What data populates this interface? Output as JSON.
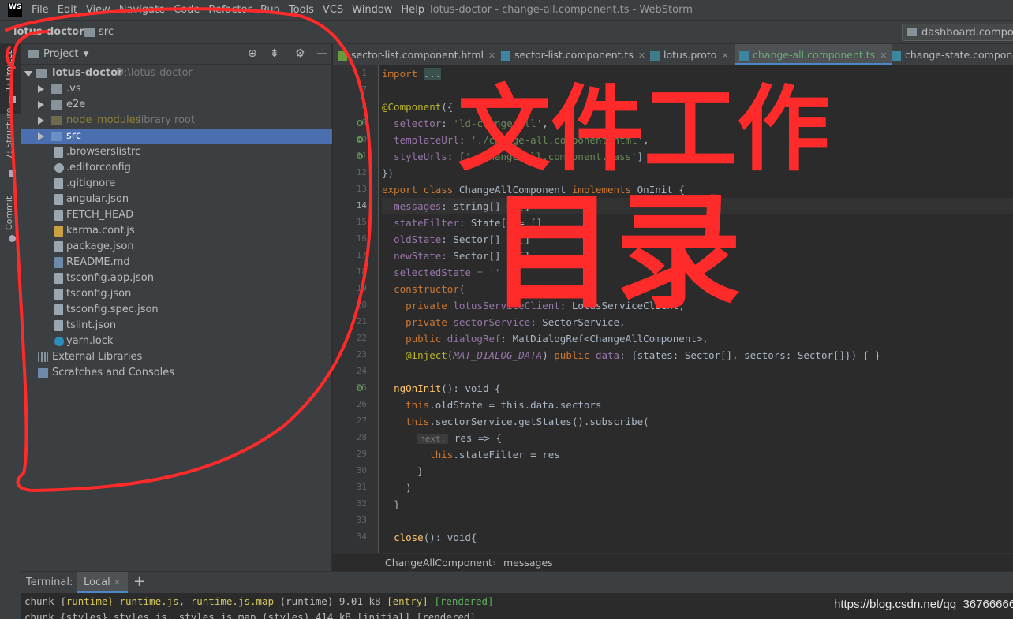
{
  "window": {
    "title": "lotus-doctor - change-all.component.ts - WebStorm",
    "logo": "WS"
  },
  "menu": [
    "File",
    "Edit",
    "View",
    "Navigate",
    "Code",
    "Refactor",
    "Run",
    "Tools",
    "VCS",
    "Window",
    "Help"
  ],
  "nav": {
    "root": "lotus-doctor",
    "folder": "src",
    "run_config": "dashboard.component"
  },
  "toolstrip": {
    "project": "1: Project",
    "structure": "7: Structure",
    "commit": "Commit"
  },
  "project_panel": {
    "title": "Project",
    "tree": [
      {
        "label": "lotus-doctor",
        "hint": "D:\\lotus-doctor"
      },
      {
        "label": ".vs"
      },
      {
        "label": "e2e"
      },
      {
        "label": "node_modules",
        "hint": "library root"
      },
      {
        "label": "src"
      },
      {
        "label": ".browserslistrc"
      },
      {
        "label": ".editorconfig"
      },
      {
        "label": ".gitignore"
      },
      {
        "label": "angular.json"
      },
      {
        "label": "FETCH_HEAD"
      },
      {
        "label": "karma.conf.js"
      },
      {
        "label": "package.json"
      },
      {
        "label": "README.md"
      },
      {
        "label": "tsconfig.app.json"
      },
      {
        "label": "tsconfig.json"
      },
      {
        "label": "tsconfig.spec.json"
      },
      {
        "label": "tslint.json"
      },
      {
        "label": "yarn.lock"
      },
      {
        "label": "External Libraries"
      },
      {
        "label": "Scratches and Consoles"
      }
    ]
  },
  "tabs": [
    {
      "label": "sector-list.component.html"
    },
    {
      "label": "sector-list.component.ts"
    },
    {
      "label": "lotus.proto"
    },
    {
      "label": "change-all.component.ts"
    },
    {
      "label": "change-state.component"
    }
  ],
  "gutter": [
    "1",
    "7",
    "8",
    "9",
    "10",
    "11",
    "12",
    "13",
    "14",
    "15",
    "16",
    "17",
    "18",
    "19",
    "20",
    "21",
    "22",
    "23",
    "24",
    "25",
    "26",
    "27",
    "28",
    "29",
    "30",
    "31",
    "32",
    "33",
    "34"
  ],
  "code": {
    "l1_kw": "import",
    "l1_fold": "...",
    "l8_ann": "@Component",
    "l8_rest": "({",
    "l9_fld": "selector",
    "l9_str": "'ld-change-all'",
    "l10_fld": "templateUrl",
    "l10_str": "'./change-all.component.html'",
    "l11_fld": "styleUrls",
    "l11_str": "'./change-all.component.sass'",
    "l12": "})",
    "l13_kw1": "export class",
    "l13_cls": "ChangeAllComponent",
    "l13_kw2": "implements",
    "l13_rest": "OnInit {",
    "l14_fld": "messages",
    "l14_rest": ": string[] = []",
    "l15_fld": "stateFilter",
    "l15_rest": ": State[] = []",
    "l16_fld": "oldState",
    "l16_rest": ": Sector[] = []",
    "l17_fld": "newState",
    "l17_rest": ": Sector[] = []",
    "l18_fld": "selectedState",
    "l18_rest": " = ''",
    "l19_kw": "constructor",
    "l19_rest": "(",
    "l20_kw": "private",
    "l20_fld": "lotusServiceClient",
    "l20_rest": ": LotusServiceClient,",
    "l21_kw": "private",
    "l21_fld": "sectorService",
    "l21_rest": ": SectorService,",
    "l22_kw": "public",
    "l22_fld": "dialogRef",
    "l22_rest": ": MatDialogRef<ChangeAllComponent>,",
    "l23_ann": "@Inject",
    "l23_arg": "MAT_DIALOG_DATA",
    "l23_kw": "public",
    "l23_fld": "data",
    "l23_rest": ": {states: Sector[], sectors: Sector[]}) { }",
    "l25_fn": "ngOnInit",
    "l25_rest": "(): void {",
    "l26_kw": "this",
    "l26_rest": ".oldState = this.data.sectors",
    "l27_kw": "this",
    "l27_rest": ".sectorService.getStates().subscribe(",
    "l28_hint": "next:",
    "l28_rest": " res => {",
    "l29_kw": "this",
    "l29_rest": ".stateFilter = res",
    "l30": "}",
    "l31": ")",
    "l32": "}",
    "l34_fn": "close",
    "l34_rest": "(): void{"
  },
  "breadcrumb": [
    "ChangeAllComponent",
    "messages"
  ],
  "terminal": {
    "label": "Terminal:",
    "tab": "Local",
    "line1_a": "chunk {",
    "line1_b": "runtime",
    "line1_c": "} runtime.js, runtime.js.map",
    "line1_d": " (runtime) 9.01 kB ",
    "line1_e": "[entry]",
    "line1_f": "[rendered]",
    "line2": "chunk {styles} styles.js, styles.js.map (styles) 414 kB [initial] [rendered]"
  },
  "watermark": "https://blog.csdn.net/qq_36766666",
  "annotation": {
    "text1": "文件工作",
    "text2": "目录",
    "color": "#ff2a2a"
  }
}
